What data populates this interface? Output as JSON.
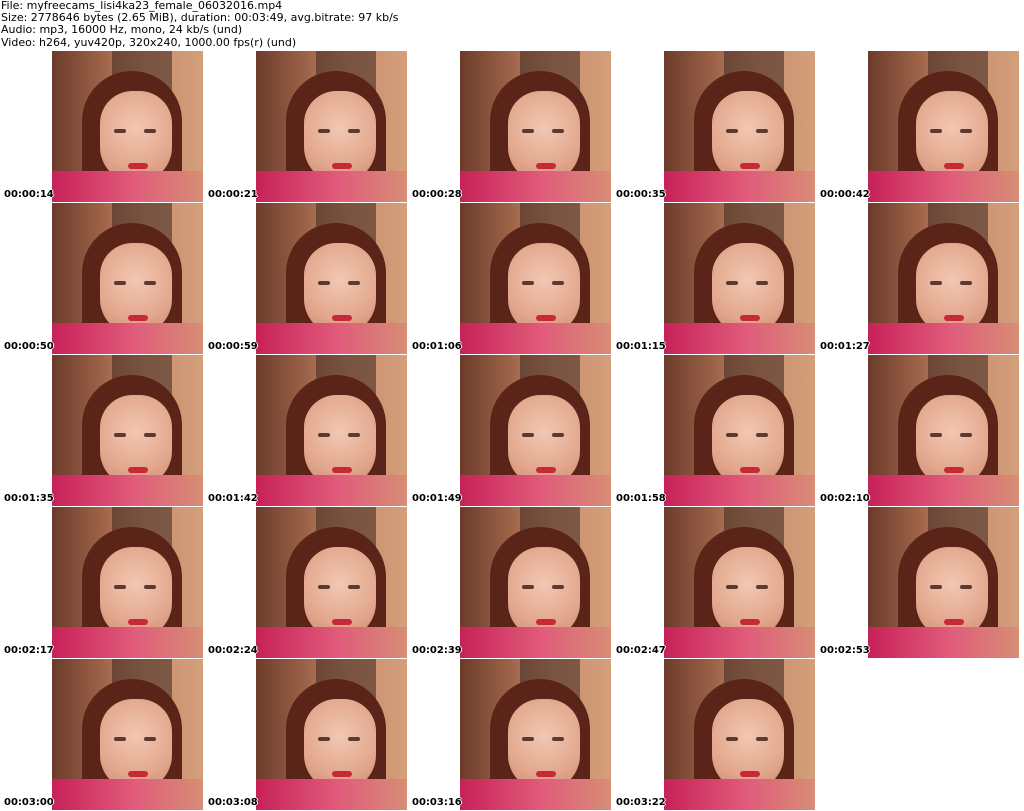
{
  "header": {
    "file_line": "File: myfreecams_lisi4ka23_female_06032016.mp4",
    "size_line": "Size: 2778646 bytes (2.65 MiB), duration: 00:03:49, avg.bitrate: 97 kb/s",
    "audio_line": "Audio: mp3, 16000 Hz, mono, 24 kb/s (und)",
    "video_line": "Video: h264, yuv420p, 320x240, 1000.00 fps(r) (und)"
  },
  "thumbnails": [
    {
      "time": "00:00:14"
    },
    {
      "time": "00:00:21"
    },
    {
      "time": "00:00:28"
    },
    {
      "time": "00:00:35"
    },
    {
      "time": "00:00:42"
    },
    {
      "time": "00:00:50"
    },
    {
      "time": "00:00:59"
    },
    {
      "time": "00:01:06"
    },
    {
      "time": "00:01:15"
    },
    {
      "time": "00:01:27"
    },
    {
      "time": "00:01:35"
    },
    {
      "time": "00:01:42"
    },
    {
      "time": "00:01:49"
    },
    {
      "time": "00:01:58"
    },
    {
      "time": "00:02:10"
    },
    {
      "time": "00:02:17"
    },
    {
      "time": "00:02:24"
    },
    {
      "time": "00:02:39"
    },
    {
      "time": "00:02:47"
    },
    {
      "time": "00:02:53"
    },
    {
      "time": "00:03:00"
    },
    {
      "time": "00:03:08"
    },
    {
      "time": "00:03:16"
    },
    {
      "time": "00:03:22"
    }
  ]
}
